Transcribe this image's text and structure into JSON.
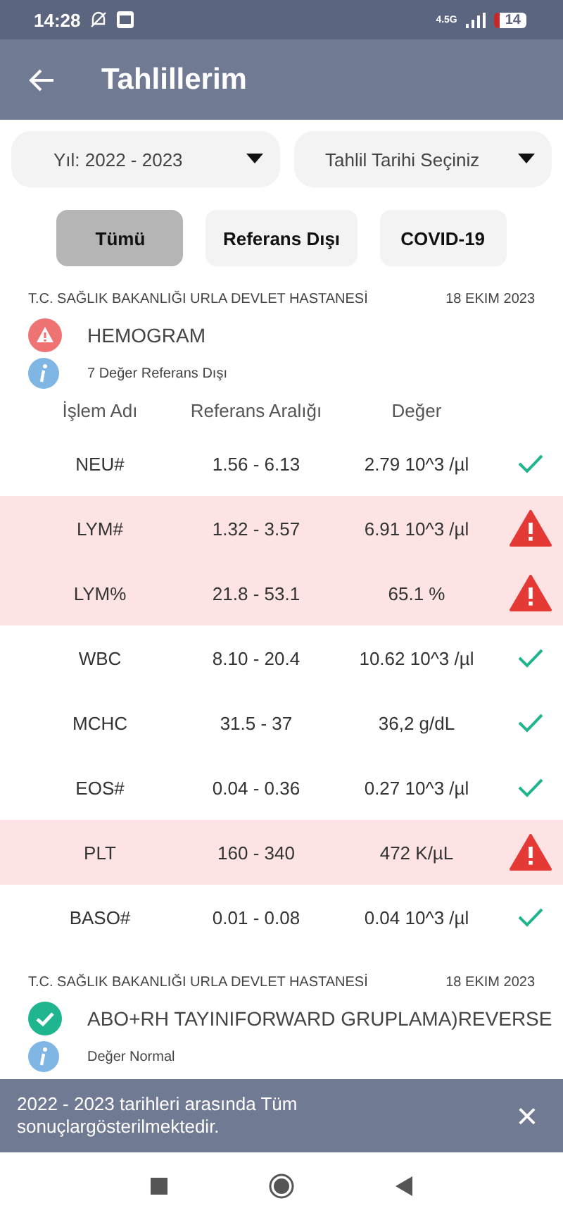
{
  "status_bar": {
    "time": "14:28",
    "network": "4.5G",
    "battery": "14"
  },
  "app_bar": {
    "title": "Tahlillerim"
  },
  "filters": [
    {
      "label": "Yıl: 2022 - 2023"
    },
    {
      "label": "Tahlil Tarihi Seçiniz"
    }
  ],
  "chips": [
    {
      "label": "Tümü",
      "selected": true
    },
    {
      "label": "Referans Dışı",
      "selected": false
    },
    {
      "label": "COVID-19",
      "selected": false
    }
  ],
  "results": [
    {
      "hospital": "T.C. SAĞLIK BAKANLIĞI URLA DEVLET HASTANESİ",
      "date": "18 EKIM 2023",
      "abnormal": true,
      "test_name": "HEMOGRAM",
      "summary": "7 Değer Referans Dışı",
      "columns": [
        "İşlem Adı",
        "Referans Aralığı",
        "Değer"
      ],
      "rows": [
        {
          "name": "NEU#",
          "range": "1.56 - 6.13",
          "value": "2.79 10^3 /µl",
          "out_of_range": false
        },
        {
          "name": "LYM#",
          "range": "1.32 - 3.57",
          "value": "6.91 10^3 /µl",
          "out_of_range": true
        },
        {
          "name": "LYM%",
          "range": "21.8 - 53.1",
          "value": "65.1 %",
          "out_of_range": true
        },
        {
          "name": "WBC",
          "range": "8.10 - 20.4",
          "value": "10.62 10^3 /µl",
          "out_of_range": false
        },
        {
          "name": "MCHC",
          "range": "31.5 - 37",
          "value": "36,2 g/dL",
          "out_of_range": false
        },
        {
          "name": "EOS#",
          "range": "0.04 - 0.36",
          "value": "0.27 10^3 /µl",
          "out_of_range": false
        },
        {
          "name": "PLT",
          "range": "160 - 340",
          "value": "472 K/µL",
          "out_of_range": true
        },
        {
          "name": "BASO#",
          "range": "0.01 - 0.08",
          "value": "0.04 10^3 /µl",
          "out_of_range": false
        }
      ]
    },
    {
      "hospital": "T.C. SAĞLIK BAKANLIĞI URLA DEVLET HASTANESİ",
      "date": "18 EKIM 2023",
      "abnormal": false,
      "test_name": "ABO+RH TAYINIFORWARD GRUPLAMA)REVERSE",
      "summary": "Değer Normal"
    }
  ],
  "snackbar": {
    "message": "2022 - 2023 tarihleri arasında Tüm sonuçlargösterilmektedir.",
    "close": "×"
  }
}
